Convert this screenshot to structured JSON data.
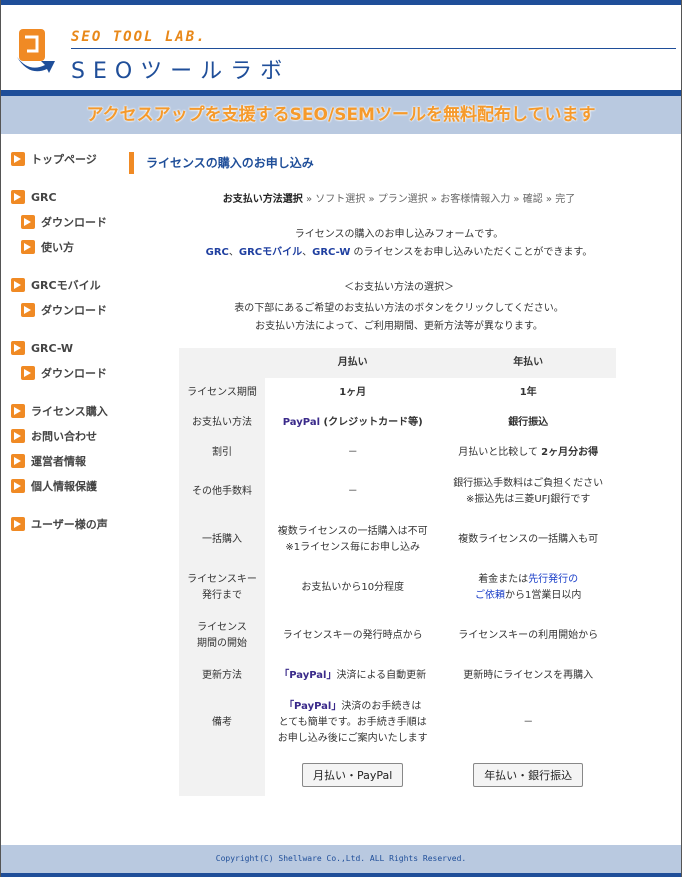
{
  "header": {
    "logo_en": "SEO TOOL LAB.",
    "logo_jp": "SEOツールラボ",
    "banner": "アクセスアップを支援するSEO/SEMツールを無料配布しています"
  },
  "sidebar": {
    "items": [
      {
        "label": "トップページ"
      },
      {
        "label": "GRC"
      },
      {
        "label": "ダウンロード"
      },
      {
        "label": "使い方"
      },
      {
        "label": "GRCモバイル"
      },
      {
        "label": "ダウンロード"
      },
      {
        "label": "GRC-W"
      },
      {
        "label": "ダウンロード"
      },
      {
        "label": "ライセンス購入"
      },
      {
        "label": "お問い合わせ"
      },
      {
        "label": "運営者情報"
      },
      {
        "label": "個人情報保護"
      },
      {
        "label": "ユーザー様の声"
      }
    ]
  },
  "main": {
    "title": "ライセンスの購入のお申し込み",
    "steps": {
      "current": "お支払い方法選択",
      "sep": " » ",
      "rest": [
        "ソフト選択",
        "プラン選択",
        "お客様情報入力",
        "確認",
        "完了"
      ]
    },
    "intro": {
      "line1": "ライセンスの購入のお申し込みフォームです。",
      "product1": "GRC",
      "comma1": "、",
      "product2": "GRCモバイル",
      "comma2": "、",
      "product3": "GRC-W",
      "line2_rest": " のライセンスをお申し込みいただくことができます。"
    },
    "method_title": "＜お支払い方法の選択＞",
    "method_desc1": "表の下部にあるご希望のお支払い方法のボタンをクリックしてください。",
    "method_desc2": "お支払い方法によって、ご利用期間、更新方法等が異なります。"
  },
  "table": {
    "headers": {
      "monthly": "月払い",
      "yearly": "年払い"
    },
    "rows": {
      "period": {
        "label": "ライセンス期間",
        "monthly": "1ヶ月",
        "yearly": "1年"
      },
      "payment": {
        "label": "お支払い方法",
        "monthly_pp": "PayPal",
        "monthly_rest": " (クレジットカード等)",
        "yearly": "銀行振込"
      },
      "discount": {
        "label": "割引",
        "monthly": "－",
        "yearly_pre": "月払いと比較して ",
        "yearly_bold": "2ヶ月分お得"
      },
      "fees": {
        "label": "その他手数料",
        "monthly": "－",
        "yearly1": "銀行振込手数料はご負担ください",
        "yearly2": "※振込先は三菱UFJ銀行です"
      },
      "bulk": {
        "label": "一括購入",
        "monthly1": "複数ライセンスの一括購入は不可",
        "monthly2": "※1ライセンス毎にお申し込み",
        "yearly": "複数ライセンスの一括購入も可"
      },
      "issue": {
        "label1": "ライセンスキー",
        "label2": "発行まで",
        "monthly": "お支払いから10分程度",
        "yearly_pre": "着金または",
        "yearly_link1": "先行発行の",
        "yearly_link2": "ご依頼",
        "yearly_post": "から1営業日以内"
      },
      "start": {
        "label1": "ライセンス",
        "label2": "期間の開始",
        "monthly": "ライセンスキーの発行時点から",
        "yearly": "ライセンスキーの利用開始から"
      },
      "renew": {
        "label": "更新方法",
        "monthly_pp": "「PayPal」",
        "monthly_rest": "決済による自動更新",
        "yearly": "更新時にライセンスを再購入"
      },
      "notes": {
        "label": "備考",
        "monthly_pp": "「PayPal」",
        "monthly_rest1": "決済のお手続きは",
        "monthly2": "とても簡単です。お手続き手順は",
        "monthly3": "お申し込み後にご案内いたします",
        "yearly": "－"
      }
    },
    "buttons": {
      "monthly": "月払い・PayPal",
      "yearly": "年払い・銀行振込"
    }
  },
  "footer": {
    "copyright": "Copyright(C) Shellware Co.,Ltd. ALL Rights Reserved."
  }
}
